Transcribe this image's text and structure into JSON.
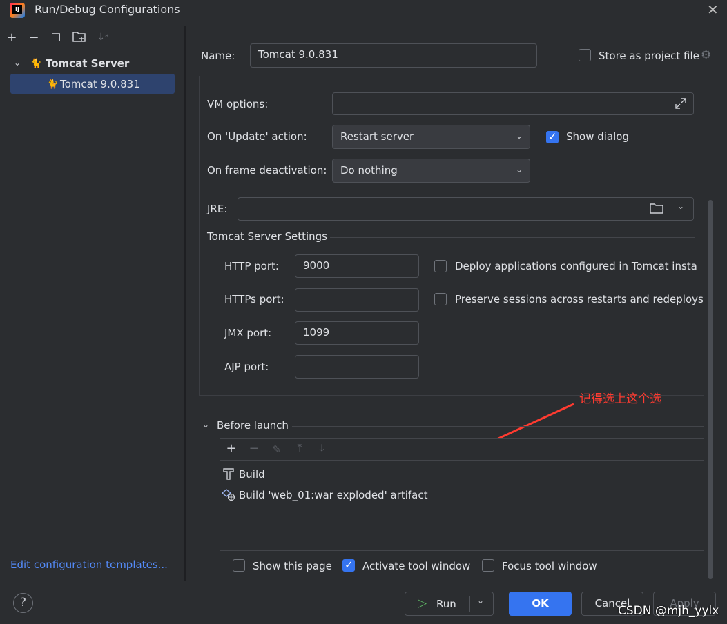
{
  "window": {
    "title": "Run/Debug Configurations"
  },
  "left": {
    "toolbar": [
      "add-icon",
      "remove-icon",
      "copy-icon",
      "new-folder-icon",
      "sort-icon"
    ],
    "tree_root": "Tomcat Server",
    "tree_child": "Tomcat 9.0.831",
    "edit_templates": "Edit configuration templates..."
  },
  "form": {
    "name_label": "Name:",
    "name_value": "Tomcat 9.0.831",
    "store_label": "Store as project file",
    "vm_label": "VM options:",
    "vm_value": "",
    "update_label": "On 'Update' action:",
    "update_value": "Restart server",
    "show_dialog": "Show dialog",
    "frame_label": "On frame deactivation:",
    "frame_value": "Do nothing",
    "jre_label": "JRE:",
    "jre_value": ""
  },
  "tomcat": {
    "title": "Tomcat Server Settings",
    "http_label": "HTTP port:",
    "http_value": "9000",
    "https_label": "HTTPs port:",
    "https_value": "",
    "jmx_label": "JMX port:",
    "jmx_value": "1099",
    "ajp_label": "AJP port:",
    "ajp_value": "",
    "deploy_label": "Deploy applications configured in Tomcat instan",
    "preserve_label": "Preserve sessions across restarts and redeploys"
  },
  "before_launch": {
    "title": "Before launch",
    "items": [
      "Build",
      "Build 'web_01:war exploded' artifact"
    ]
  },
  "options": {
    "show_page": "Show this page",
    "activate": "Activate tool window",
    "focus": "Focus tool window"
  },
  "buttons": {
    "run": "Run",
    "ok": "OK",
    "cancel": "Cancel",
    "apply": "Apply",
    "help": "?"
  },
  "annotation": "记得选上这个选",
  "watermark": "CSDN @mjh_yylx",
  "colors": {
    "accent": "#3574f0",
    "annotation": "#ff3b30",
    "link": "#548af7"
  }
}
